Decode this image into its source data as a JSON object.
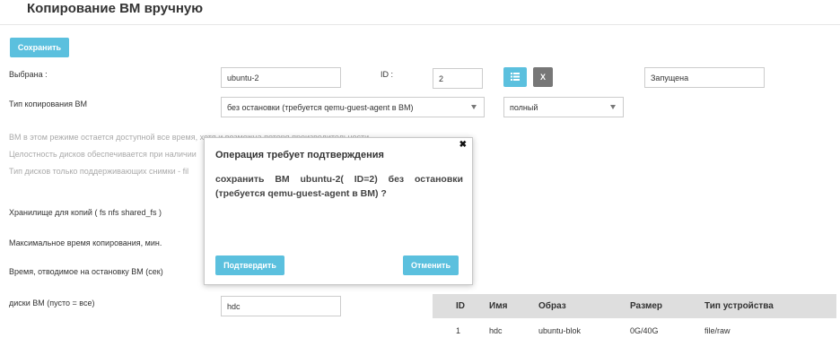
{
  "page": {
    "title": "Копирование ВМ вручную"
  },
  "toolbar": {
    "save_label": "Сохранить"
  },
  "form": {
    "selected_label": "Выбрана :",
    "selected_value": "ubuntu-2",
    "id_label": "ID :",
    "id_value": "2",
    "list_button_icon": "list-icon",
    "clear_button_label": "X",
    "status_value": "Запущена",
    "copy_type_label": "Тип копирования ВМ",
    "copy_type_value": "без остановки (требуется qemu-guest-agent в ВМ)",
    "copy_mode_value": "полный",
    "hint_1": "ВМ в этом режиме остается доступной все время, хотя и возможна потеря производительности",
    "hint_2": "Целостность дисков обеспечивается при наличии",
    "hint_3": "Тип дисков только поддерживающих снимки - fil",
    "storage_label": "Хранилище для копий ( fs nfs shared_fs )",
    "max_time_label": "Максимальное время копирования, мин.",
    "stop_time_label": "Время, отводимое на остановку ВМ (сек)",
    "disks_label": "диски ВМ (пусто = все)",
    "disks_value": "hdc"
  },
  "disks_table": {
    "columns": [
      "ID",
      "Имя",
      "Образ",
      "Размер",
      "Тип устройства"
    ],
    "rows": [
      [
        "1",
        "hdc",
        "ubuntu-blok",
        "0G/40G",
        "file/raw"
      ]
    ]
  },
  "modal": {
    "close_glyph": "✖",
    "title": "Операция требует подтверждения",
    "body": "сохранить ВМ ubuntu-2( ID=2) без остановки (требуется qemu-guest-agent в ВМ) ?",
    "confirm_label": "Подтвердить",
    "cancel_label": "Отменить"
  },
  "colors": {
    "accent": "#5bc0de",
    "gray_button": "#777777",
    "table_header": "#dedede"
  }
}
